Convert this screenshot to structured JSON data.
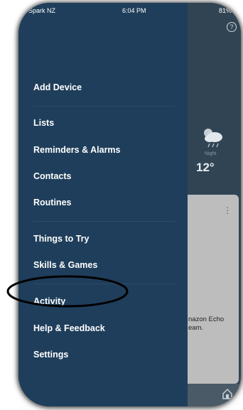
{
  "status_bar": {
    "carrier": "Spark NZ",
    "time": "6:04 PM",
    "battery": "81%"
  },
  "drawer": {
    "items": [
      {
        "label": "Add Device"
      },
      {
        "label": "Lists"
      },
      {
        "label": "Reminders & Alarms"
      },
      {
        "label": "Contacts"
      },
      {
        "label": "Routines"
      },
      {
        "label": "Things to Try"
      },
      {
        "label": "Skills & Games"
      },
      {
        "label": "Activity"
      },
      {
        "label": "Help & Feedback"
      },
      {
        "label": "Settings"
      }
    ]
  },
  "background": {
    "help_glyph": "?",
    "weather": {
      "icon": "cloud-rain-moon-icon",
      "label": "Night",
      "temperature": "12°"
    },
    "card": {
      "text": "nazon Echo\neam."
    }
  },
  "colors": {
    "drawer": "#1f3e5b",
    "annotation": "#000000"
  }
}
